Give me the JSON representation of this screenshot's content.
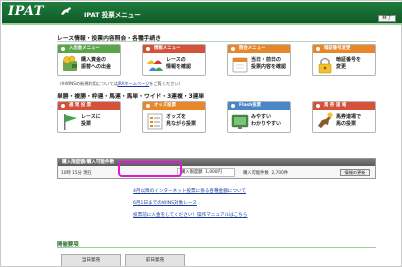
{
  "header": {
    "logo": "IPAT",
    "title": "IPAT 投票メニュー",
    "logout_label": "終了"
  },
  "section1": {
    "title": "レース情報・投票内容照会・各種手続き",
    "cards": [
      {
        "head": "入出金メニュー",
        "line1": "購入資金の",
        "line2": "振替への出金",
        "head_color": "#5aa44a",
        "icon": "coin-wallet-icon"
      },
      {
        "head": "情報メニュー",
        "line1": "レースの",
        "line2": "情報を確認",
        "head_color": "#d4513a",
        "icon": "racing-caps-icon"
      },
      {
        "head": "照会メニュー",
        "line1": "当日・前日の",
        "line2": "投票内容を確認",
        "head_color": "#e8862a",
        "icon": "calendar-icon"
      },
      {
        "head": "暗証番号変更",
        "line1": "暗証番号を",
        "line2": "変更",
        "head_color": "#e8862a",
        "icon": "padlock-icon"
      }
    ],
    "note_prefix": "（※WINSの新規利用については",
    "note_link": "JRAホームページ",
    "note_suffix": "をご覧ください）"
  },
  "section2": {
    "title": "単勝・複勝・枠連・馬連・馬単・ワイド・3連複・3連単",
    "cards": [
      {
        "head": "通 常 投 票",
        "line1": "レースに",
        "line2": "投票",
        "head_color": "#d4513a",
        "icon": "green-flag-icon"
      },
      {
        "head": "オッズ投票",
        "line1": "オッズを",
        "line2": "見ながら投票",
        "head_color": "#e8862a",
        "icon": "odds-list-icon"
      },
      {
        "head": "Flash投票",
        "line1": "みやすい",
        "line2": "わかりやすい",
        "head_color": "#4a86c8",
        "icon": "flash-screen-icon"
      },
      {
        "head": "馬 券 道 場",
        "line1": "馬券道場で",
        "line2": "馬の投票",
        "head_color": "#d4513a",
        "icon": "no1-horse-icon"
      }
    ]
  },
  "purchase": {
    "head": "購入限度額/購入可能件数",
    "time": "10時 15分 現在",
    "amount_label": "購入限度額",
    "amount_value": "1,000円",
    "avail_label": "購入可能件数",
    "avail_value": "2,700件",
    "update_label": "情報の更新"
  },
  "news": [
    "4月以降のインターネット投票に係る各種金額について",
    "6月1日までのWINS対象レース",
    "投票前に入金をしてください！操作マニュアルはこちら"
  ],
  "bottom": {
    "title": "開催要項",
    "tabs": [
      "当日発売",
      "前日発売"
    ]
  },
  "colors": {
    "header": "#0f5a28",
    "accent": "#5aa44a",
    "highlight": "#e01ad0"
  }
}
